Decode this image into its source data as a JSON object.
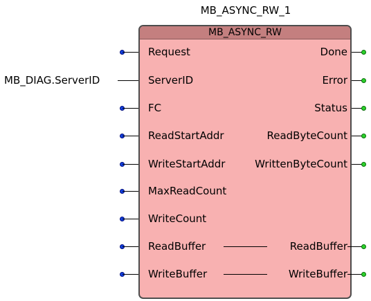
{
  "block": {
    "instance_name": "MB_ASYNC_RW_1",
    "type_name": "MB_ASYNC_RW"
  },
  "inputs": [
    {
      "label": "Request"
    },
    {
      "label": "ServerID",
      "connection": "MB_DIAG.ServerID"
    },
    {
      "label": "FC"
    },
    {
      "label": "ReadStartAddr"
    },
    {
      "label": "WriteStartAddr"
    },
    {
      "label": "MaxReadCount"
    },
    {
      "label": "WriteCount"
    },
    {
      "label": "ReadBuffer"
    },
    {
      "label": "WriteBuffer"
    }
  ],
  "outputs": [
    {
      "label": "Done"
    },
    {
      "label": "Error"
    },
    {
      "label": "Status"
    },
    {
      "label": "ReadByteCount"
    },
    {
      "label": "WrittenByteCount"
    },
    {
      "label": ""
    },
    {
      "label": ""
    },
    {
      "label": "ReadBuffer"
    },
    {
      "label": "WriteBuffer"
    }
  ],
  "colors": {
    "block_fill": "#f8b1b1",
    "header_fill": "#c47f7f",
    "input_pin": "#1240e0",
    "output_pin": "#2bd12b"
  }
}
